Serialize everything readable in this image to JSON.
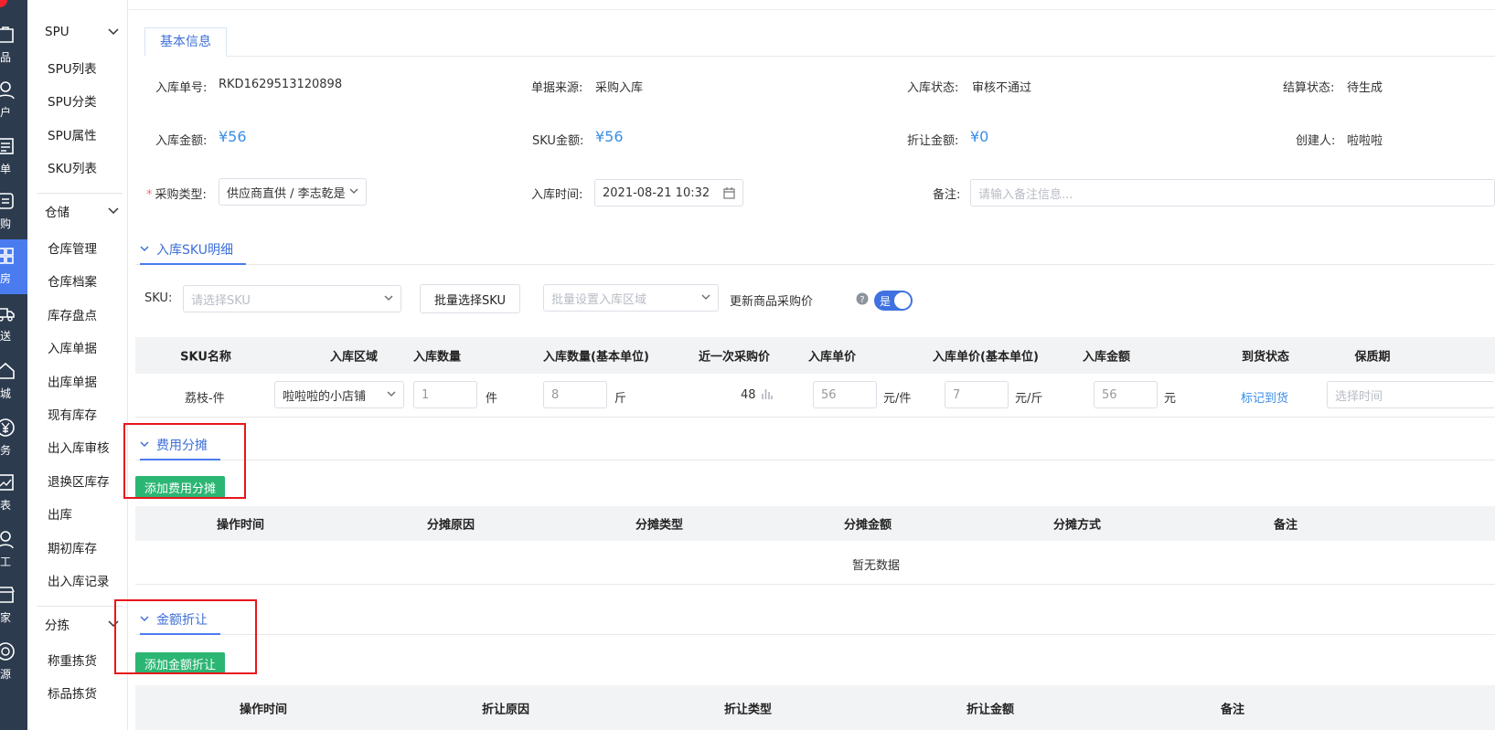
{
  "rail": [
    {
      "label": "商品",
      "icon": "bag-icon"
    },
    {
      "label": "客户",
      "icon": "user-icon"
    },
    {
      "label": "订单",
      "icon": "list-icon"
    },
    {
      "label": "采购",
      "icon": "purchase-icon"
    },
    {
      "label": "库房",
      "icon": "grid-icon"
    },
    {
      "label": "配送",
      "icon": "truck-icon"
    },
    {
      "label": "商城",
      "icon": "home-icon"
    },
    {
      "label": "财务",
      "icon": "yen-icon"
    },
    {
      "label": "报表",
      "icon": "chart-icon"
    },
    {
      "label": "员工",
      "icon": "staff-icon"
    },
    {
      "label": "商家",
      "icon": "shop-icon"
    },
    {
      "label": "溯源",
      "icon": "trace-icon"
    }
  ],
  "submenu": {
    "groups": [
      {
        "label": "SPU",
        "items": [
          "SPU列表",
          "SPU分类",
          "SPU属性",
          "SKU列表"
        ]
      },
      {
        "label": "仓储",
        "items": [
          "仓库管理",
          "仓库档案",
          "库存盘点",
          "入库单据",
          "出库单据",
          "现有库存",
          "出入库审核",
          "退换区库存",
          "出库",
          "期初库存",
          "出入库记录"
        ]
      },
      {
        "label": "分拣",
        "items": [
          "称重拣货",
          "标品拣货"
        ]
      }
    ]
  },
  "tab": "基本信息",
  "info": {
    "order_no_label": "入库单号:",
    "order_no": "RKD1629513120898",
    "source_label": "单据来源:",
    "source": "采购入库",
    "status_label": "入库状态:",
    "status": "审核不通过",
    "settle_label": "结算状态:",
    "settle": "待生成",
    "amount_label": "入库金额:",
    "amount": "¥56",
    "sku_amount_label": "SKU金额:",
    "sku_amount": "¥56",
    "discount_label": "折让金额:",
    "discount": "¥0",
    "creator_label": "创建人:",
    "creator": "啦啦啦",
    "purchase_type_label": "采购类型:",
    "purchase_type": "供应商直供 / 李志乾是",
    "time_label": "入库时间:",
    "time": "2021-08-21 10:32",
    "remark_label": "备注:",
    "remark_placeholder": "请输入备注信息..."
  },
  "sku_section": {
    "title": "入库SKU明细",
    "sku_label": "SKU:",
    "sku_placeholder": "请选择SKU",
    "batch_button": "批量选择SKU",
    "area_placeholder": "批量设置入库区域",
    "update_price_label": "更新商品采购价",
    "toggle_text": "是",
    "columns": [
      "SKU名称",
      "入库区域",
      "入库数量",
      "入库数量(基本单位)",
      "近一次采购价",
      "入库单价",
      "入库单价(基本单位)",
      "入库金额",
      "到货状态",
      "保质期"
    ],
    "row": {
      "name": "荔枝-件",
      "area": "啦啦啦的小店铺",
      "qty": "1",
      "qty_unit": "件",
      "base_qty": "8",
      "base_unit": "斤",
      "last_price": "48",
      "price": "56",
      "price_unit": "元/件",
      "base_price": "7",
      "base_price_unit": "元/斤",
      "amount": "56",
      "amount_unit": "元",
      "arrival_link": "标记到货",
      "expiry_placeholder": "选择时间"
    }
  },
  "fee_section": {
    "title": "费用分摊",
    "add_button": "添加费用分摊",
    "columns": [
      "操作时间",
      "分摊原因",
      "分摊类型",
      "分摊金额",
      "分摊方式",
      "备注"
    ],
    "empty": "暂无数据"
  },
  "discount_section": {
    "title": "金额折让",
    "add_button": "添加金额折让",
    "columns": [
      "操作时间",
      "折让原因",
      "折让类型",
      "折让金额",
      "备注"
    ]
  },
  "colors": {
    "accent": "#4a7cf0",
    "link": "#3a8ee6",
    "green": "#2bb673",
    "rail": "#2c3b4e",
    "highlight": "#e8161b"
  }
}
